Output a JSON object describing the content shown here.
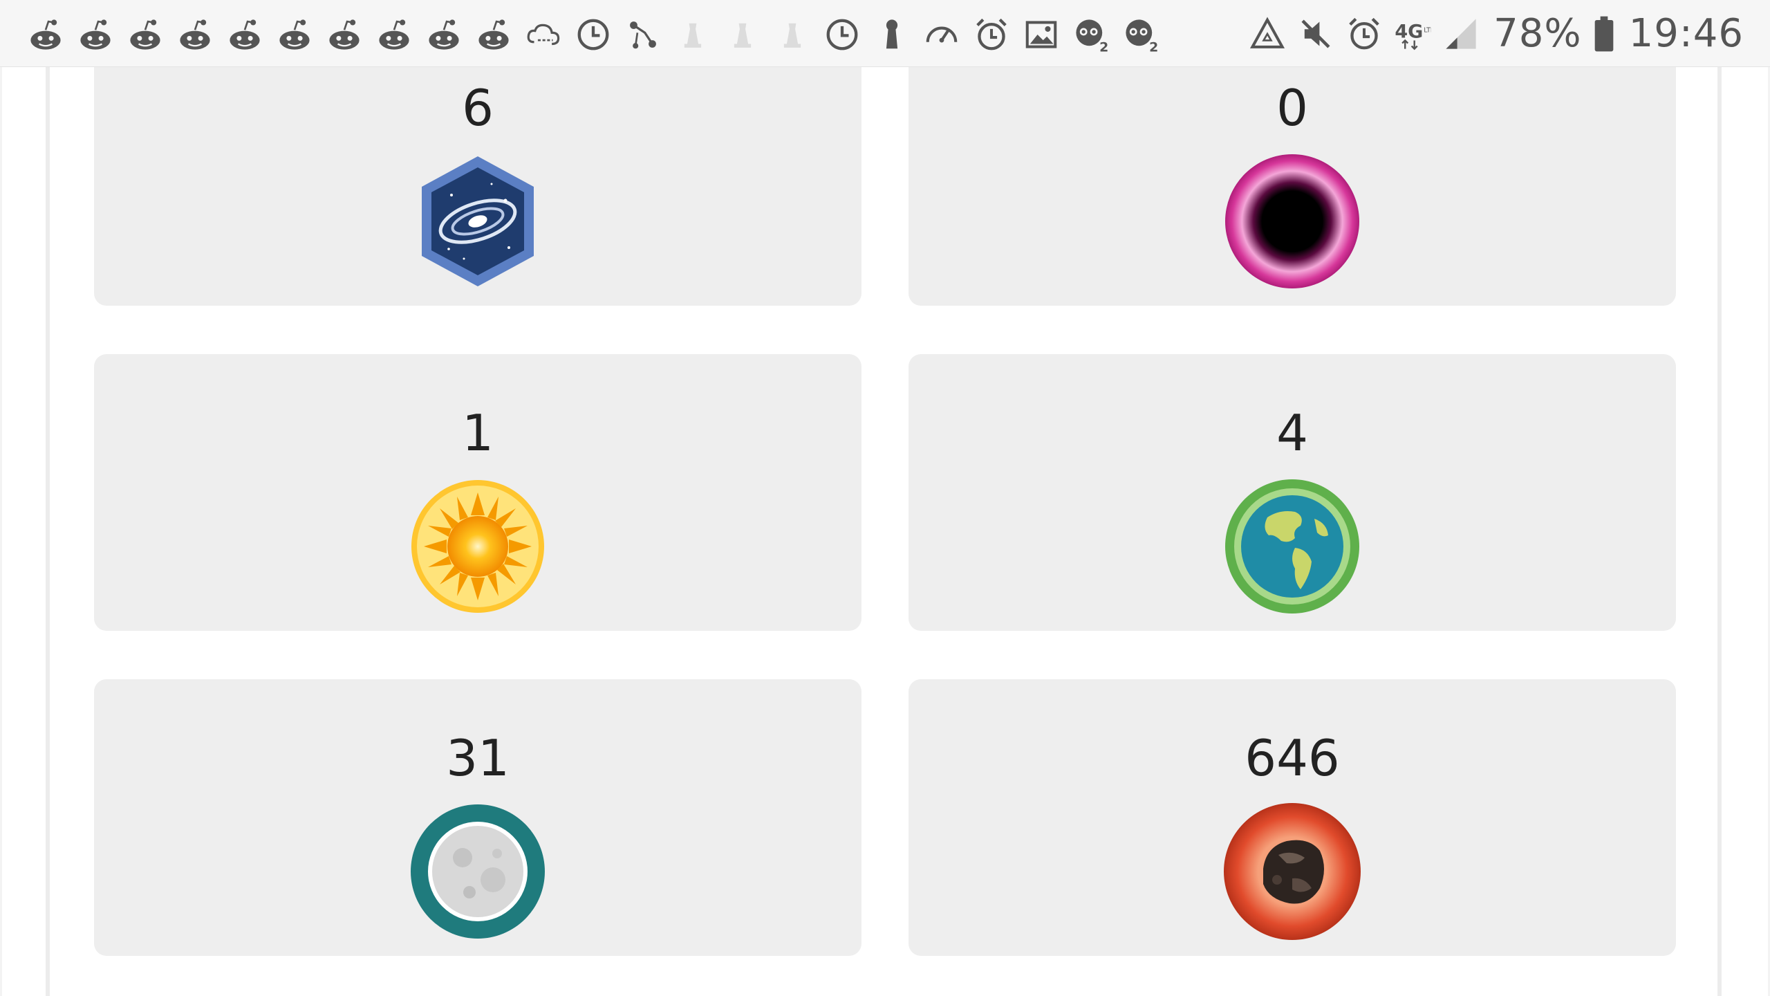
{
  "status_bar": {
    "notification_icons": [
      "reddit-alien-icon",
      "reddit-alien-icon",
      "reddit-alien-icon",
      "reddit-alien-icon",
      "reddit-alien-icon",
      "reddit-alien-icon",
      "reddit-alien-icon",
      "reddit-alien-icon",
      "reddit-alien-icon",
      "reddit-alien-icon",
      "cloud-sync-icon",
      "clock-icon",
      "route-icon",
      "chess-piece-icon",
      "chess-piece-icon",
      "chess-piece-icon",
      "clock-icon",
      "keyhole-icon",
      "speedometer-icon",
      "alarm-icon",
      "image-icon",
      "face-badge-icon",
      "face-badge-icon"
    ],
    "system_icons": [
      "recycle-alert-icon",
      "mute-icon",
      "alarm-icon",
      "network-4g-lte-icon",
      "signal-icon",
      "battery-icon"
    ],
    "network_label": "4G",
    "network_sub": "LTE",
    "battery_percent": "78%",
    "battery_level": 0.78,
    "time": "19:46"
  },
  "cards": [
    {
      "count": "6",
      "badge": "galaxy-badge-icon",
      "colors": {
        "primary": "#5b7fc4",
        "secondary": "#1f3c6e"
      }
    },
    {
      "count": "0",
      "badge": "black-hole-badge-icon",
      "colors": {
        "primary": "#d6379a",
        "secondary": "#000000"
      }
    },
    {
      "count": "1",
      "badge": "sun-badge-icon",
      "colors": {
        "primary": "#ffc62f",
        "secondary": "#f28b00"
      }
    },
    {
      "count": "4",
      "badge": "earth-badge-icon",
      "colors": {
        "primary": "#5fb04b",
        "secondary": "#1f8ca6"
      }
    },
    {
      "count": "31",
      "badge": "moon-badge-icon",
      "colors": {
        "primary": "#1f7b7d",
        "secondary": "#d8d8d8"
      }
    },
    {
      "count": "646",
      "badge": "asteroid-badge-icon",
      "colors": {
        "primary": "#e14b2c",
        "secondary": "#2d2420"
      }
    }
  ]
}
